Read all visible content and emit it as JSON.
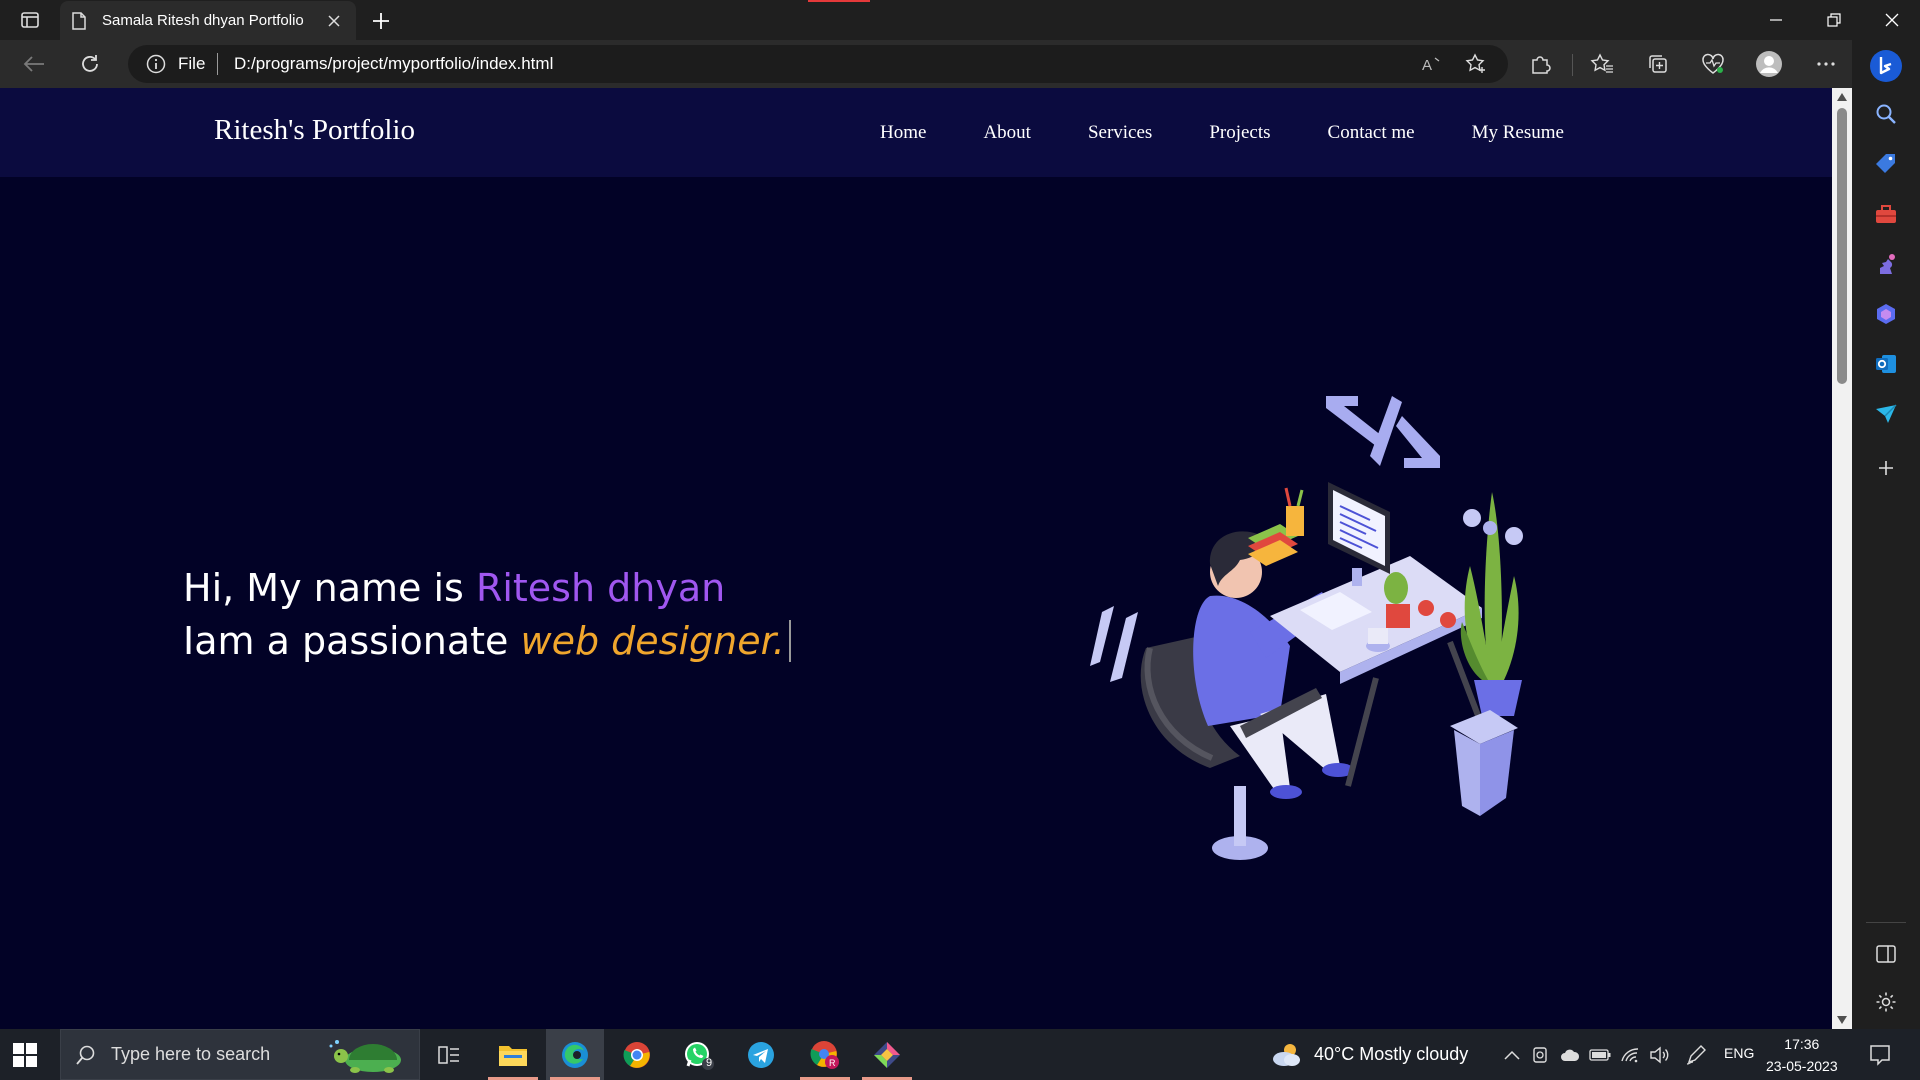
{
  "browser": {
    "tab_title": "Samala Ritesh dhyan Portfolio",
    "url_scheme": "File",
    "url": "D:/programs/project/myportfolio/index.html"
  },
  "page": {
    "brand": "Ritesh's Portfolio",
    "nav": [
      {
        "label": "Home"
      },
      {
        "label": "About"
      },
      {
        "label": "Services"
      },
      {
        "label": "Projects"
      },
      {
        "label": "Contact me"
      },
      {
        "label": "My Resume"
      }
    ],
    "hero": {
      "line1_prefix": "Hi, My name is ",
      "line1_name": "Ritesh dhyan",
      "line2_prefix": "Iam a passionate ",
      "line2_role": "web designer."
    }
  },
  "taskbar": {
    "search_placeholder": "Type here to search",
    "whatsapp_badge": "9",
    "weather": "40°C  Mostly cloudy",
    "language": "ENG",
    "time": "17:36",
    "date": "23-05-2023"
  },
  "colors": {
    "page_bg": "#020226",
    "navbar_bg": "#0b0b3f",
    "name_accent": "#a057f0",
    "role_accent": "#f0a62d"
  }
}
